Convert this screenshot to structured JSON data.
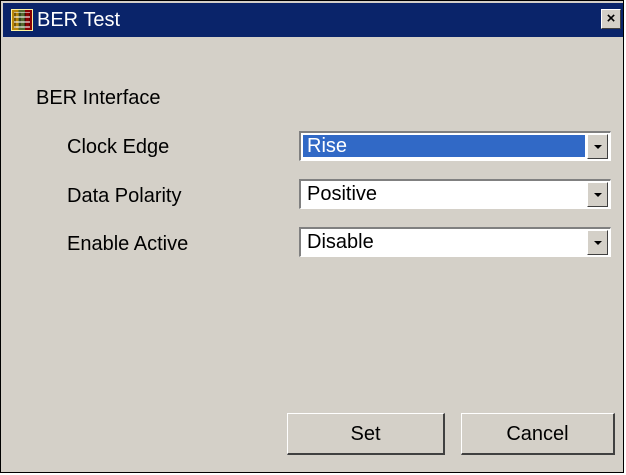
{
  "window": {
    "title": "BER Test",
    "close_glyph": "×",
    "app_icon": "app-icon"
  },
  "group": {
    "label": "BER Interface"
  },
  "fields": {
    "clock_edge": {
      "label": "Clock Edge",
      "value": "Rise"
    },
    "data_polarity": {
      "label": "Data Polarity",
      "value": "Positive"
    },
    "enable_active": {
      "label": "Enable Active",
      "value": "Disable"
    }
  },
  "buttons": {
    "set_label": "Set",
    "cancel_label": "Cancel"
  },
  "colors": {
    "titlebar": "#0a246a",
    "window_bg": "#d4d0c8",
    "selection": "#3169c6"
  }
}
